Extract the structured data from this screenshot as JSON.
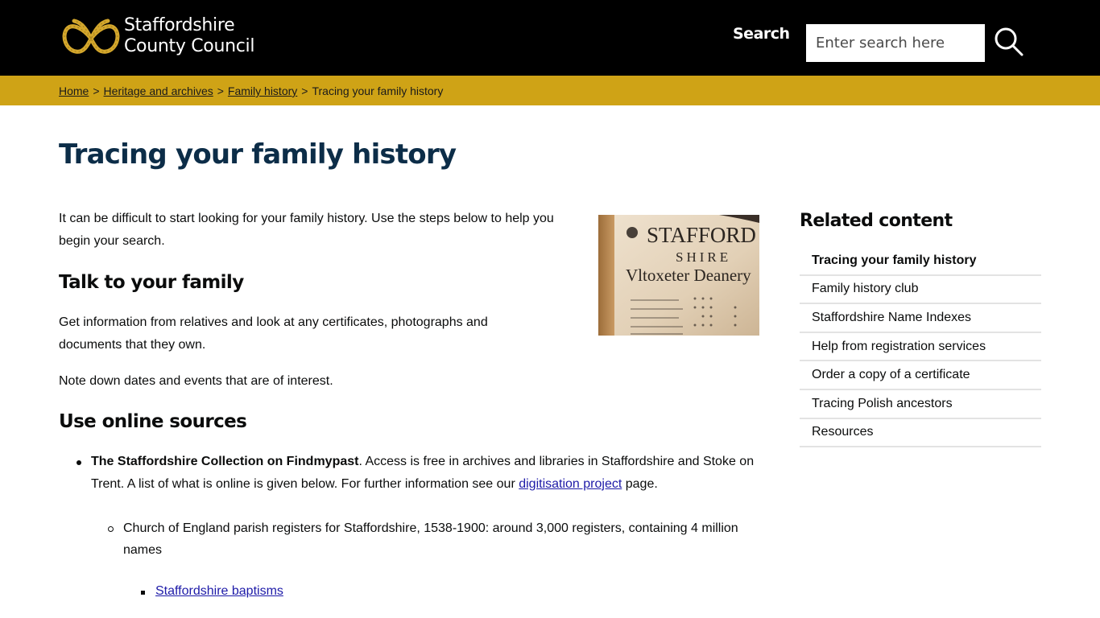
{
  "header": {
    "logo": {
      "line1": "Staffordshire",
      "line2": "County Council",
      "icon": "staffordshire-knot-icon",
      "knot_color": "#d4a72c"
    },
    "search": {
      "label": "Search",
      "placeholder": "Enter search here",
      "value": "",
      "button_icon": "search-icon"
    },
    "background_color": "#000000"
  },
  "breadcrumb": {
    "background_color": "#cfa316",
    "items": [
      {
        "label": "Home",
        "link": true
      },
      {
        "label": "Heritage and archives",
        "link": true
      },
      {
        "label": "Family history",
        "link": true
      },
      {
        "label": "Tracing your family history",
        "link": false
      }
    ],
    "separator": ">"
  },
  "main": {
    "title": "Tracing your family history",
    "title_color": "#0c2d48",
    "intro": "It can be difficult to start looking for your family history. Use the steps below to help you begin your search.",
    "image": {
      "alt": "Staffordshire Vltoxeter Deanery register page",
      "printed_text": [
        "STAFFORD",
        "SHIRE",
        "Vltoxeter Deanery"
      ]
    },
    "sections": [
      {
        "heading": "Talk to your family",
        "paragraphs": [
          "Get information from relatives and look at any certificates, photographs and documents that they own.",
          "Note down dates and events that are of interest."
        ]
      },
      {
        "heading": "Use online sources",
        "list": [
          {
            "bold": "The Staffordshire Collection on Findmypast",
            "text_after_bold": ".  Access is free in archives and libraries in Staffordshire and Stoke on Trent. A list of what is online is given below.  For further information see our ",
            "link": "digitisation project",
            "text_end": " page.",
            "sublist": [
              {
                "text": "Church of England parish registers for Staffordshire, 1538-1900: around 3,000 registers, containing 4 million names",
                "sublist": [
                  {
                    "link": "Staffordshire baptisms"
                  }
                ]
              }
            ]
          }
        ]
      }
    ]
  },
  "sidebar": {
    "title": "Related content",
    "items": [
      {
        "label": "Tracing your family history",
        "current": true
      },
      {
        "label": "Family history club",
        "current": false
      },
      {
        "label": "Staffordshire Name Indexes",
        "current": false
      },
      {
        "label": "Help from registration services",
        "current": false
      },
      {
        "label": "Order a copy of a certificate",
        "current": false
      },
      {
        "label": "Tracing Polish ancestors",
        "current": false
      },
      {
        "label": "Resources",
        "current": false
      }
    ]
  },
  "colors": {
    "link": "#1d1aa8",
    "divider": "#e3e3e3"
  }
}
